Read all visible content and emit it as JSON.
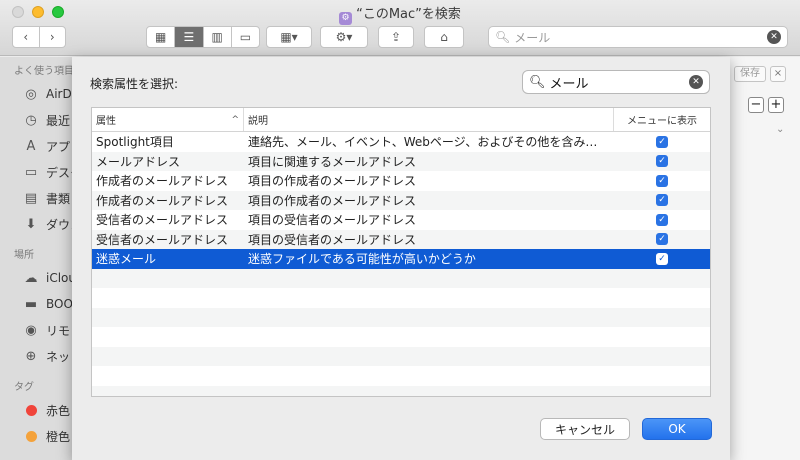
{
  "window": {
    "title": "“このMac”を検索",
    "search_placeholder": "メール"
  },
  "toolbar": {
    "back": "‹",
    "forward": "›",
    "view_icons": [
      "▦",
      "☰",
      "▥",
      "▭"
    ],
    "group_icon": "▦▾",
    "action_icon": "⚙▾",
    "share_icon": "⇪",
    "tag_icon": "⌂"
  },
  "sidebar": {
    "favorites_header": "よく使う項目",
    "favorites": [
      {
        "label": "AirDrop",
        "icon": "airdrop-icon"
      },
      {
        "label": "最近",
        "icon": "clock-icon"
      },
      {
        "label": "アプリ",
        "icon": "apps-icon"
      },
      {
        "label": "デスク",
        "icon": "desktop-icon"
      },
      {
        "label": "書類",
        "icon": "document-icon"
      },
      {
        "label": "ダウン",
        "icon": "download-icon"
      }
    ],
    "locations_header": "場所",
    "locations": [
      {
        "label": "iCloud",
        "icon": "cloud-icon"
      },
      {
        "label": "BOO",
        "icon": "disk-icon"
      },
      {
        "label": "リモ",
        "icon": "remote-disc-icon"
      },
      {
        "label": "ネット",
        "icon": "network-icon"
      }
    ],
    "tags_header": "タグ",
    "tags": [
      {
        "label": "赤色",
        "color": "#f0443a"
      },
      {
        "label": "橙色",
        "color": "#f4a23b"
      }
    ]
  },
  "right_panel": {
    "save": "保存",
    "close": "×",
    "minus": "−",
    "plus": "+"
  },
  "dialog": {
    "label": "検索属性を選択:",
    "search_value": "メール",
    "columns": {
      "attribute": "属性",
      "description": "説明",
      "show_in_menu": "メニューに表示"
    },
    "rows": [
      {
        "attribute": "Spotlight項目",
        "description": "連絡先、メール、イベント、Webページ、およびその他を含み…",
        "checked": true,
        "selected": false
      },
      {
        "attribute": "メールアドレス",
        "description": "項目に関連するメールアドレス",
        "checked": true,
        "selected": false
      },
      {
        "attribute": "作成者のメールアドレス",
        "description": "項目の作成者のメールアドレス",
        "checked": true,
        "selected": false
      },
      {
        "attribute": "作成者のメールアドレス",
        "description": "項目の作成者のメールアドレス",
        "checked": true,
        "selected": false
      },
      {
        "attribute": "受信者のメールアドレス",
        "description": "項目の受信者のメールアドレス",
        "checked": true,
        "selected": false
      },
      {
        "attribute": "受信者のメールアドレス",
        "description": "項目の受信者のメールアドレス",
        "checked": true,
        "selected": false
      },
      {
        "attribute": "迷惑メール",
        "description": "迷惑ファイルである可能性が高いかどうか",
        "checked": true,
        "selected": true
      }
    ],
    "cancel": "キャンセル",
    "ok": "OK",
    "accent_color": "#0f5bd4"
  }
}
